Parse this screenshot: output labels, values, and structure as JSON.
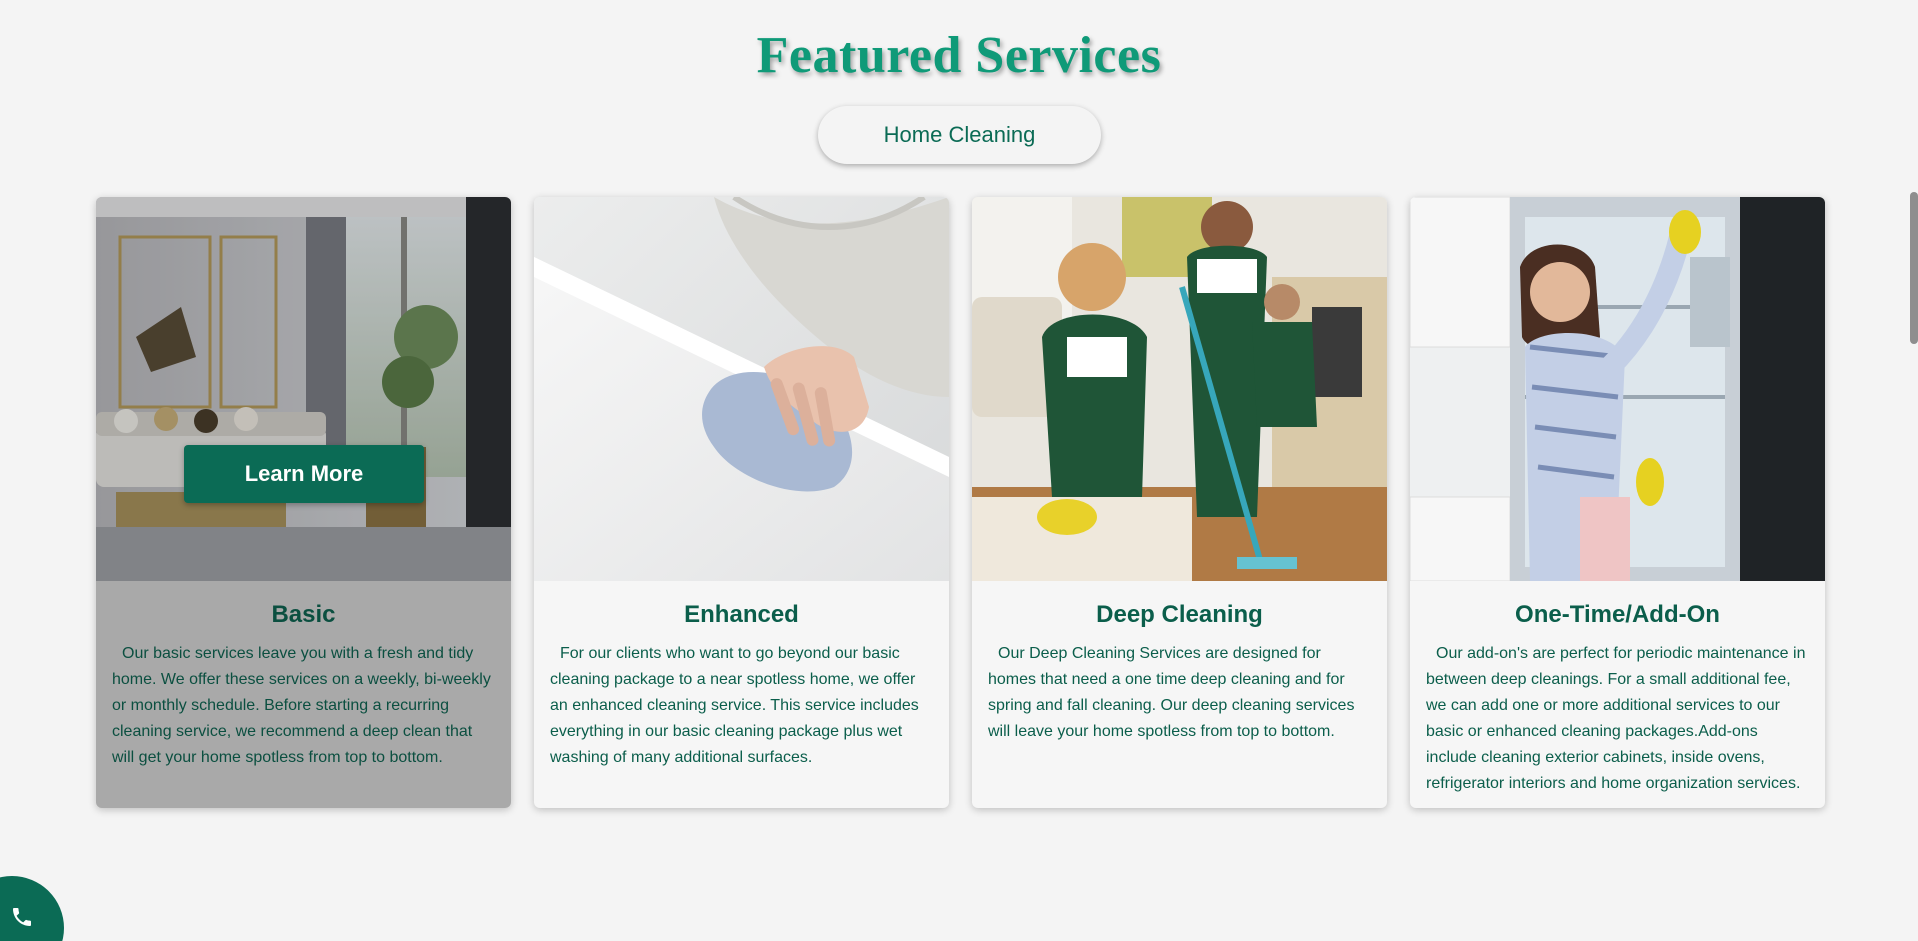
{
  "section": {
    "title": "Featured Services",
    "category_button": "Home Cleaning"
  },
  "cards": [
    {
      "title": "Basic",
      "text": "Our basic services leave you with a fresh and tidy home. We offer these services on a weekly, bi-weekly or monthly schedule. Before starting a recurring cleaning service, we recommend a deep clean that will get your home spotless from top to bottom.",
      "button": "Learn More",
      "image": "living-room-photo"
    },
    {
      "title": "Enhanced",
      "text": "For our clients who want to go beyond our basic cleaning package to a near spotless home, we offer an enhanced cleaning service. This service includes everything in our basic cleaning package plus wet washing of many additional surfaces.",
      "image": "wiping-counter-photo"
    },
    {
      "title": "Deep Cleaning",
      "text": "Our Deep Cleaning Services are designed for homes that need a one time deep cleaning and for spring and fall cleaning. Our deep cleaning services will leave your home spotless from top to bottom.",
      "image": "cleaning-team-photo"
    },
    {
      "title": "One-Time/Add-On",
      "text": "Our add-on's are perfect for periodic maintenance in between deep cleanings. For a small additional fee, we can add one or more additional services to our basic or enhanced cleaning packages.Add-ons include cleaning exterior cabinets, inside ovens, refrigerator interiors and home organization services.",
      "image": "fridge-cleaning-photo"
    }
  ],
  "floating": {
    "phone_icon": "phone-icon"
  },
  "colors": {
    "brand_green": "#0b6b55",
    "title_green": "#0f9a78",
    "background": "#f4f4f4"
  }
}
